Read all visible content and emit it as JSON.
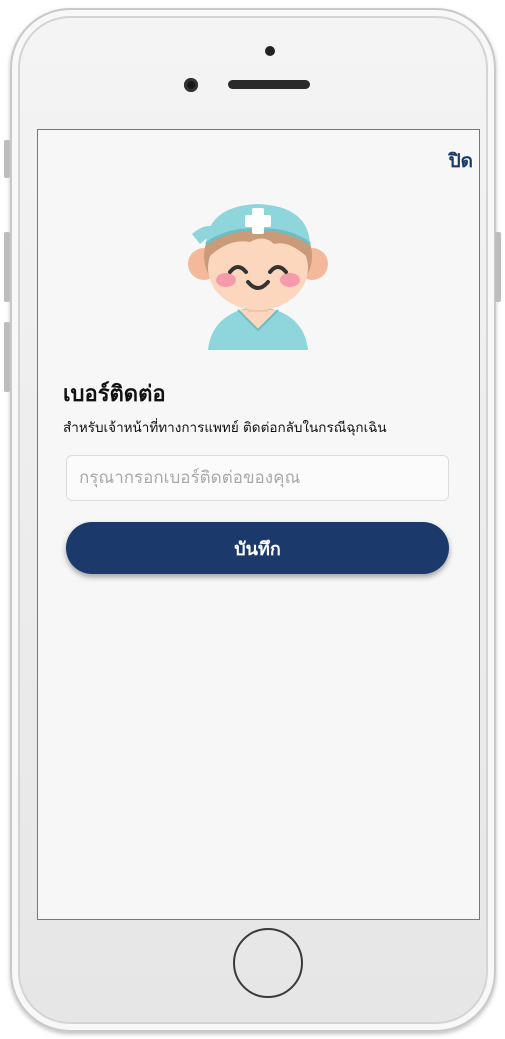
{
  "dialog": {
    "close_label": "ปิด",
    "title": "เบอร์ติดต่อ",
    "subtitle": "สำหรับเจ้าหน้าที่ทางการแพทย์ ติดต่อกลับในกรณีฉุกเฉิน",
    "phone_input": {
      "value": "",
      "placeholder": "กรุณากรอกเบอร์ติดต่อของคุณ"
    },
    "save_label": "บันทึก",
    "avatar_icon": "nurse-avatar-icon"
  },
  "colors": {
    "primary": "#1b3a6b",
    "cap": "#8fd6dc",
    "skin": "#fcd6bd",
    "hair": "#c99b78",
    "cheek": "#f59bac"
  }
}
